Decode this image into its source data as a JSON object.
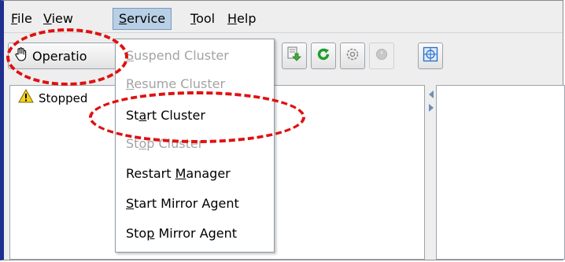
{
  "menubar": {
    "items": [
      {
        "mnemonic": "F",
        "rest": "ile"
      },
      {
        "mnemonic": "V",
        "rest": "iew"
      },
      {
        "mnemonic": "S",
        "rest": "ervice"
      },
      {
        "mnemonic": "T",
        "rest": "ool"
      },
      {
        "mnemonic": "H",
        "rest": "elp"
      }
    ]
  },
  "toolbar": {
    "operation_label": "Operatio",
    "icons": [
      "download-icon",
      "refresh-icon",
      "settings-icon",
      "disabled-circle-icon",
      "cluster-grid-icon"
    ]
  },
  "tree": {
    "status_label": "Stopped"
  },
  "service_menu": {
    "items": [
      {
        "pre": "",
        "mn": "S",
        "post": "uspend Cluster",
        "enabled": false
      },
      {
        "pre": "",
        "mn": "R",
        "post": "esume Cluster",
        "enabled": false
      },
      {
        "pre": "St",
        "mn": "a",
        "post": "rt Cluster",
        "enabled": true
      },
      {
        "pre": "St",
        "mn": "o",
        "post": "p Cluster",
        "enabled": false
      },
      {
        "pre": "Restart ",
        "mn": "M",
        "post": "anager",
        "enabled": true
      },
      {
        "pre": "",
        "mn": "S",
        "post": "tart Mirror Agent",
        "enabled": true
      },
      {
        "pre": "Sto",
        "mn": "p",
        "post": " Mirror Agent",
        "enabled": true
      }
    ]
  },
  "colors": {
    "annotation": "#e01010",
    "menu_highlight": "#b8cfe5",
    "disabled_text": "#a3a3a3"
  }
}
